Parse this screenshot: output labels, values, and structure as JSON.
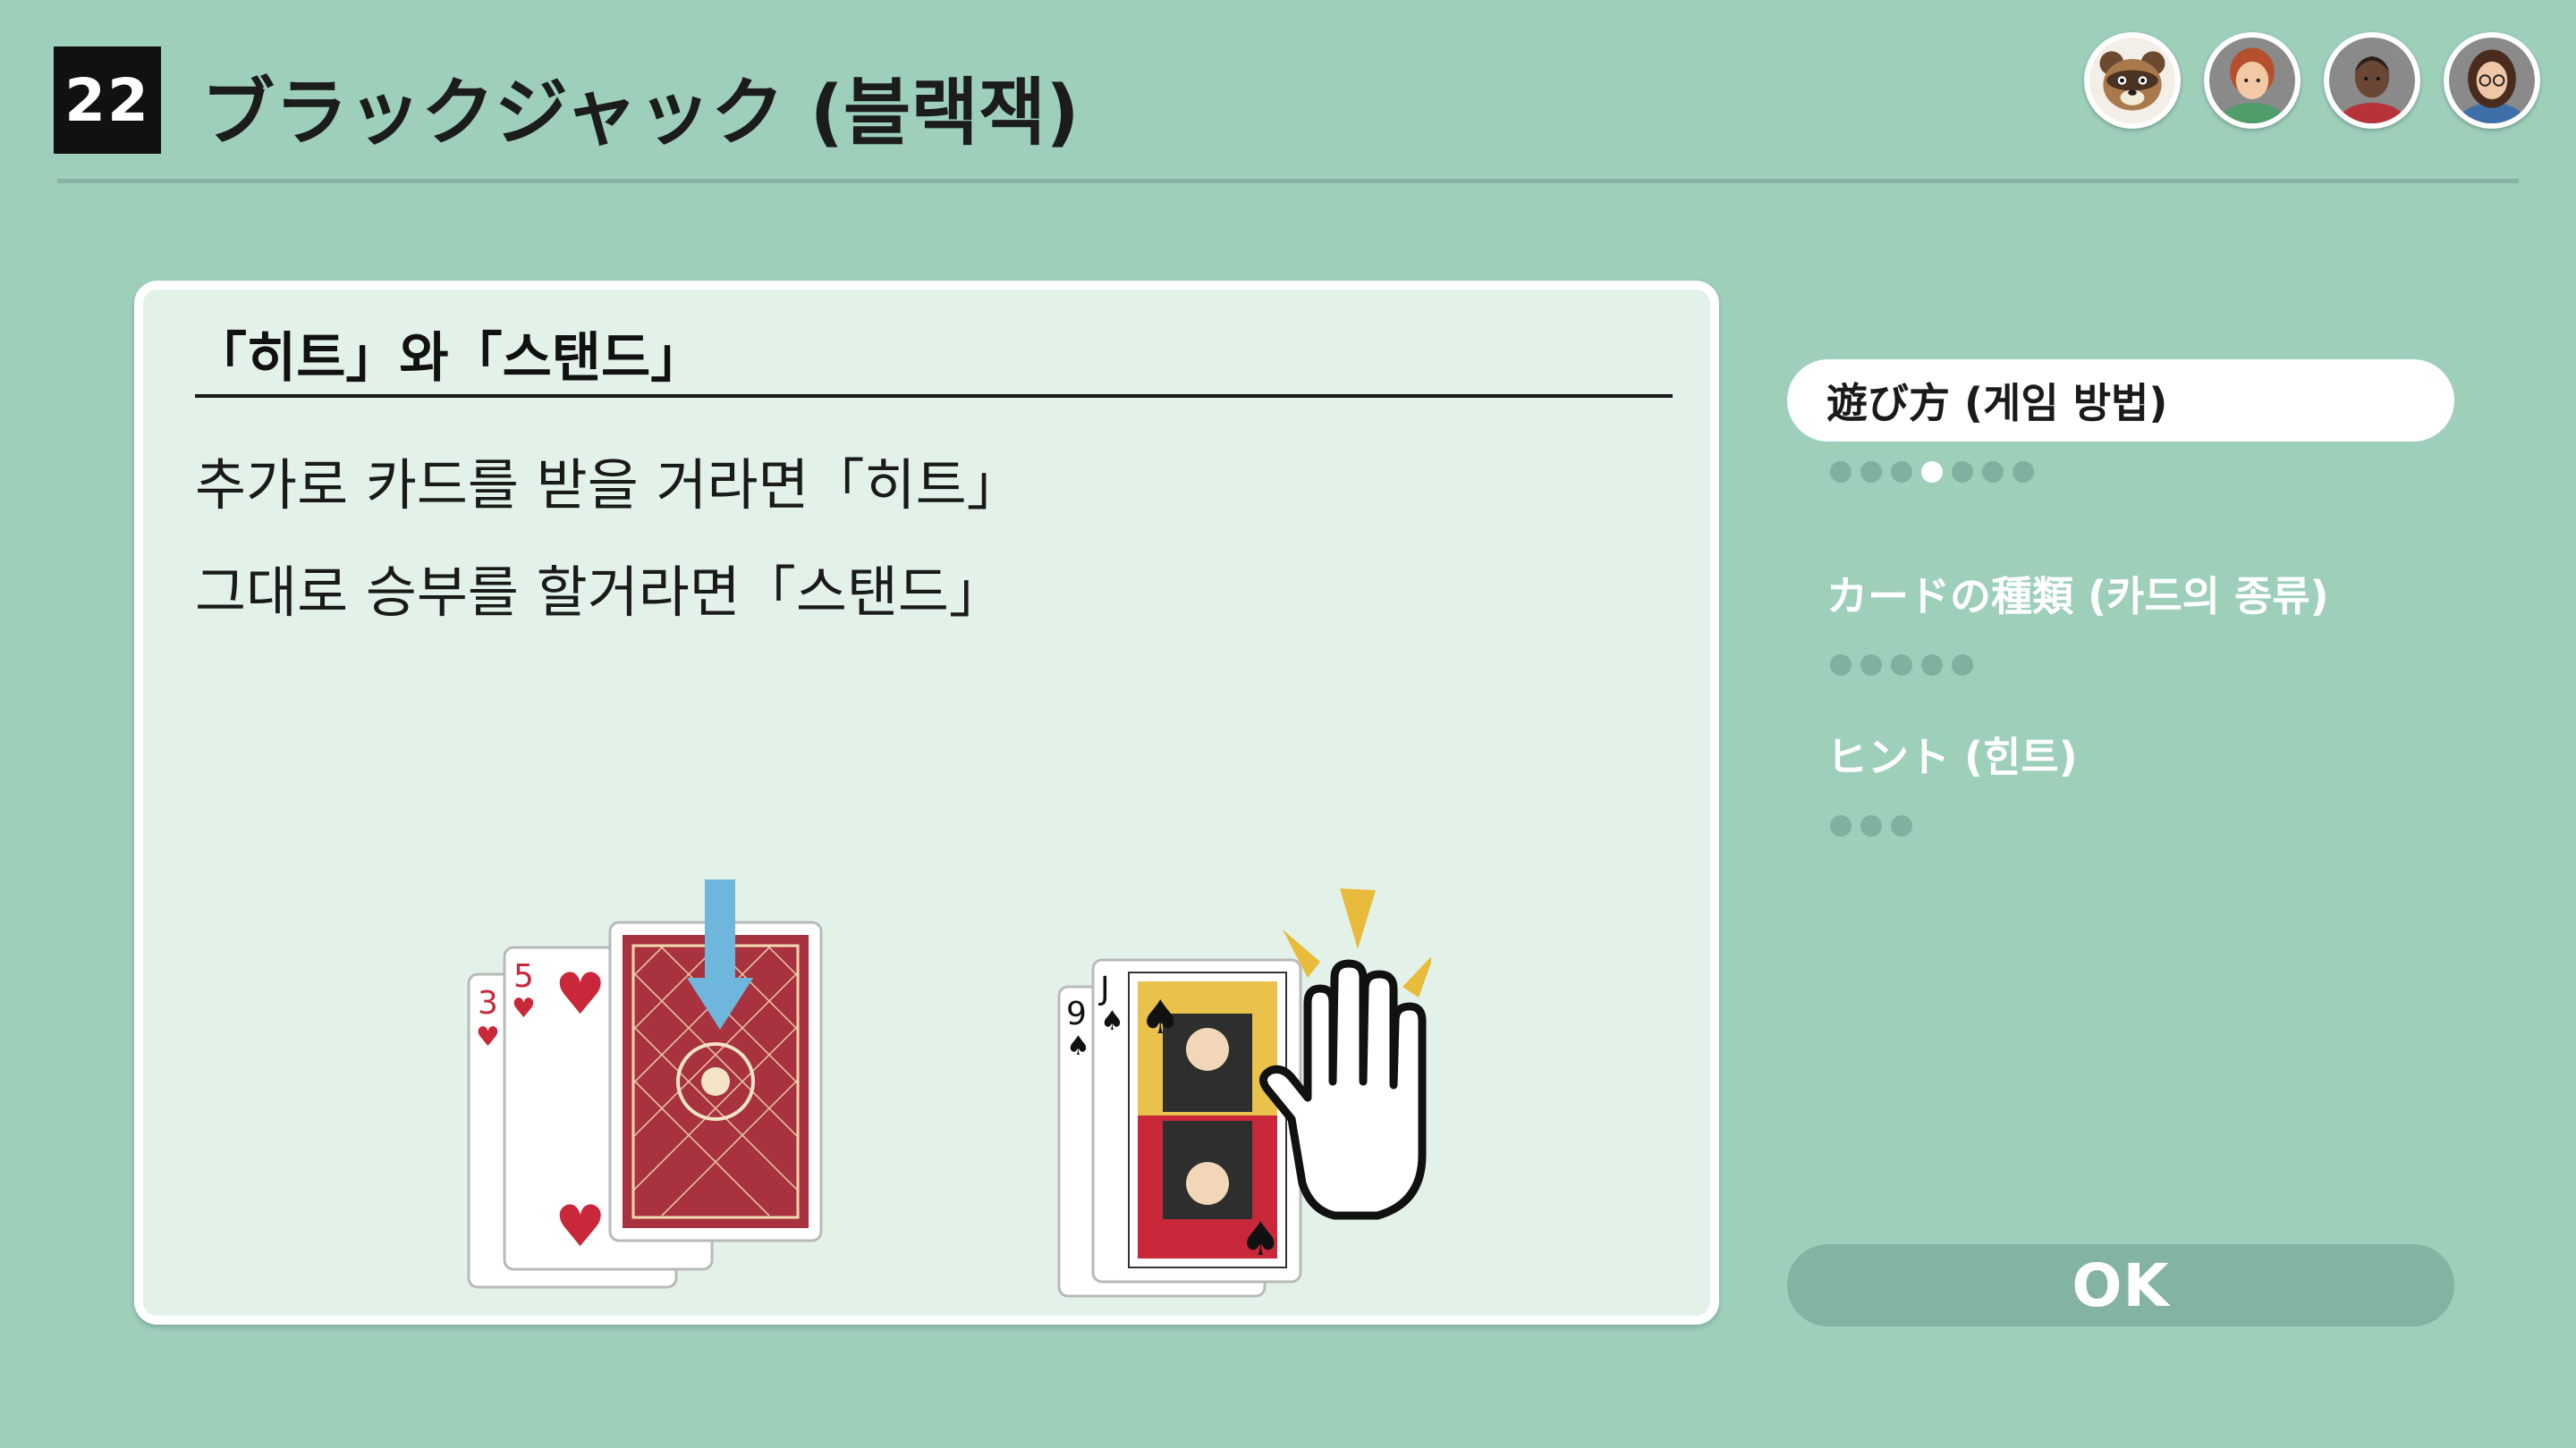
{
  "header": {
    "game_number": "22",
    "title": "ブラックジャック (블랙잭)"
  },
  "players": [
    {
      "name": "tom-nook-avatar"
    },
    {
      "name": "player-avatar-redhair"
    },
    {
      "name": "player-avatar-dark"
    },
    {
      "name": "player-avatar-glasses"
    }
  ],
  "instruction": {
    "heading": "「히트」와「스탠드」",
    "line1": "추가로 카드를 받을 거라면「히트」",
    "line2": "그대로 승부를 할거라면「스탠드」",
    "hit_cards": [
      "3♥",
      "5♥",
      "card-back"
    ],
    "stand_cards": [
      "9♠",
      "J♠"
    ]
  },
  "menu": {
    "items": [
      {
        "label": "遊び方 (게임 방법)",
        "active": true,
        "pages": 7,
        "current_page": 4
      },
      {
        "label": "カードの種類 (카드의 종류)",
        "active": false,
        "pages": 5,
        "current_page": 0
      },
      {
        "label": "ヒント (힌트)",
        "active": false,
        "pages": 3,
        "current_page": 0
      }
    ],
    "ok_label": "OK"
  },
  "colors": {
    "background": "#9dcfbb",
    "card_panel": "#e3f2e8",
    "dot_active": "#ffffff",
    "dot_inactive": "#7fb0a0",
    "arrow_blue": "#6fb6dd",
    "hearts_red": "#c8283a",
    "spark_yellow": "#e8bb3a"
  }
}
